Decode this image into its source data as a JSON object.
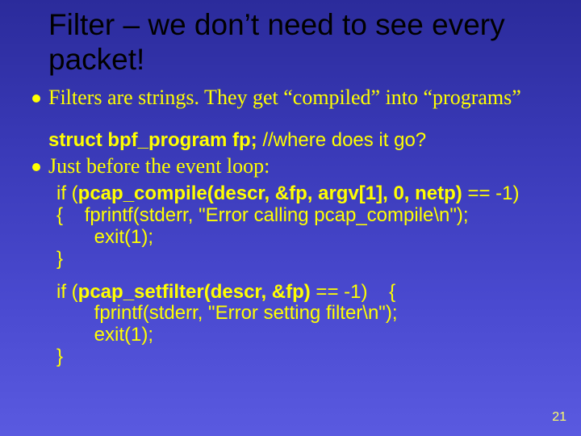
{
  "title": "Filter – we don’t need to see every packet!",
  "bullets": {
    "b1": "Filters are strings. They get “compiled” into “programs”",
    "b2": "Just before the event loop:"
  },
  "code": {
    "decl_struct": "struct bpf_program fp;",
    "decl_spacer": "    ",
    "decl_comment": "//where does it go?",
    "block1_l1_a": "if (",
    "block1_l1_b": "pcap_compile(descr, &fp, argv[1], 0, netp)",
    "block1_l1_c": " == -1)",
    "block1_l2": "{    fprintf(stderr, \"Error calling pcap_compile\\n\");",
    "block1_l3": "       exit(1);",
    "block1_l4": "}",
    "block2_l1_a": "if (",
    "block2_l1_b": "pcap_setfilter(descr, &fp)",
    "block2_l1_c": " == -1)    {",
    "block2_l2": "       fprintf(stderr, \"Error setting filter\\n\");",
    "block2_l3": "       exit(1);",
    "block2_l4": "}"
  },
  "slide_number": "21"
}
